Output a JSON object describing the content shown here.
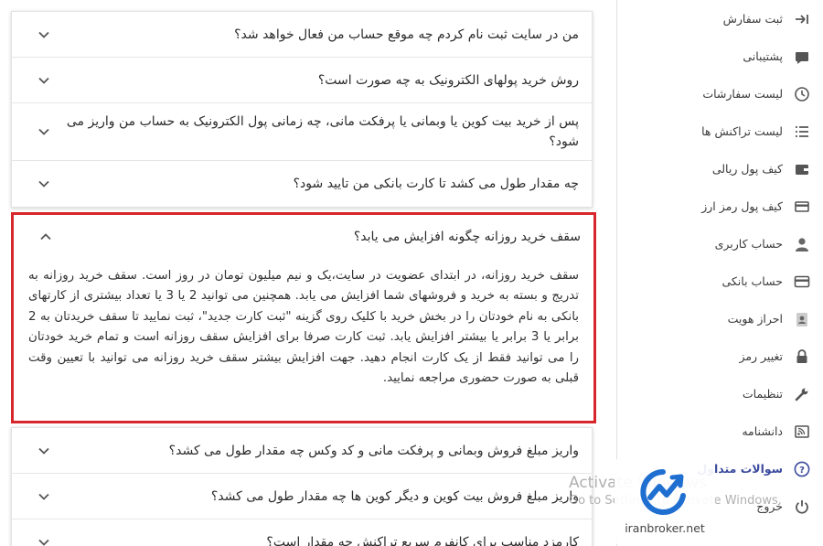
{
  "faq": {
    "top_items": [
      {
        "question": "من در سایت ثبت نام کردم چه موقع حساب من فعال خواهد شد؟"
      },
      {
        "question": "روش خرید پولهای الکترونیک به چه صورت است؟"
      },
      {
        "question": "پس از خرید بیت کوین یا وبمانی یا پرفکت مانی، چه زمانی پول الکترونیک به حساب من واریز می شود؟"
      },
      {
        "question": "چه مقدار طول می کشد تا کارت بانکی من تایید شود؟"
      }
    ],
    "expanded": {
      "question": "سقف خرید روزانه چگونه افزایش می یابد؟",
      "answer": "سقف خرید روزانه، در ابتدای عضویت در سایت،یک و نیم میلیون تومان در روز است. سقف خرید روزانه به تدریج و بسته به خرید و فروشهای شما افزایش می یابد. همچنین می توانید 2 یا 3 یا تعداد بیشتری از کارتهای بانکی به نام خودتان را در بخش خرید با کلیک روی گزینه \"ثبت کارت جدید\"، ثبت نمایید تا سقف خریدتان به 2 برابر یا 3 برابر یا بیشتر افزایش یابد. ثبت کارت صرفا برای افزایش سقف روزانه است و تمام خرید خودتان را می توانید فقط از یک کارت انجام دهید. جهت افزایش بیشتر سقف خرید روزانه می توانید با تعیین وقت قبلی به صورت حضوری مراجعه نمایید."
    },
    "bottom_items": [
      {
        "question": "واریز مبلغ فروش وبمانی و پرفکت مانی و کد وکس چه مقدار طول می کشد؟"
      },
      {
        "question": "واریز مبلغ فروش بیت کوین و دیگر کوین ها چه مقدار طول می کشد؟"
      },
      {
        "question": "کارمزد مناسب برای کانفرم سریع تراکنش چه مقدار است؟"
      }
    ]
  },
  "sidebar": {
    "items": [
      {
        "label": "ثبت سفارش",
        "icon": "order-arrow-icon"
      },
      {
        "label": "پشتیبانی",
        "icon": "support-chat-icon"
      },
      {
        "label": "لیست سفارشات",
        "icon": "history-clock-icon"
      },
      {
        "label": "لیست تراکنش ها",
        "icon": "list-icon"
      },
      {
        "label": "کیف پول ریالی",
        "icon": "wallet-icon"
      },
      {
        "label": "کیف پول رمز ارز",
        "icon": "crypto-wallet-icon"
      },
      {
        "label": "حساب کاربری",
        "icon": "user-icon"
      },
      {
        "label": "حساب بانکی",
        "icon": "bank-card-icon"
      },
      {
        "label": "احراز هویت",
        "icon": "id-badge-icon"
      },
      {
        "label": "تغییر رمز",
        "icon": "lock-icon"
      },
      {
        "label": "تنظیمات",
        "icon": "wrench-icon"
      },
      {
        "label": "دانشنامه",
        "icon": "knowledge-feed-icon"
      },
      {
        "label": "سوالات متداول",
        "icon": "help-circle-icon",
        "active": true
      },
      {
        "label": "خروج",
        "icon": "power-icon"
      }
    ]
  },
  "watermark": {
    "line1": "Activate Windows",
    "line2": "Go to Settings to activate Windows."
  },
  "logo": {
    "text": "iranbroker.net"
  },
  "colors": {
    "highlight_border": "#d7262c",
    "active_menu": "#3c4b9e",
    "logo_blue": "#1f6fd1"
  }
}
